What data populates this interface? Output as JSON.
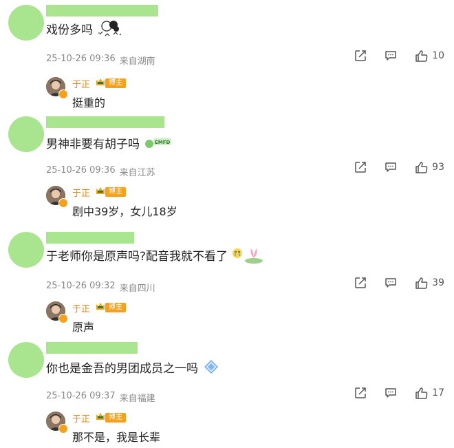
{
  "comments": [
    {
      "name_bar_width": 0,
      "text": "戏份多吗",
      "sticker": "cartoon-doodle-sticker",
      "date": "25-10-26 09:36",
      "location": "来自湖南",
      "likes": "10",
      "reply": {
        "name": "于正",
        "tag": "博主",
        "text": "挺重的"
      }
    },
    {
      "text": "男神非要有胡子吗",
      "sticker": "emoji-sticker",
      "date": "25-10-26 09:36",
      "location": "来自江苏",
      "likes": "93",
      "reply": {
        "name": "于正",
        "tag": "博主",
        "text": "剧中39岁，女儿18岁"
      }
    },
    {
      "text": "于老师你是原声吗?配音我就不看了",
      "sticker": "crying-lotus-sticker",
      "date": "25-10-26 09:32",
      "location": "来自四川",
      "likes": "39",
      "reply": {
        "name": "于正",
        "tag": "博主",
        "text": "原声"
      }
    },
    {
      "text": "你也是金吾的男团成员之一吗",
      "sticker": "diamond-sticker",
      "date": "25-10-26 09:37",
      "location": "来自福建",
      "likes": "17",
      "reply": {
        "name": "于正",
        "tag": "博主",
        "text": "那不是，我是长辈"
      }
    }
  ],
  "colors": {
    "placeholder_green": "#a9e48e",
    "meta_gray": "#888888",
    "blogger_orange": "#f7a11a"
  },
  "icons": [
    "share-icon",
    "comment-icon",
    "like-icon"
  ]
}
